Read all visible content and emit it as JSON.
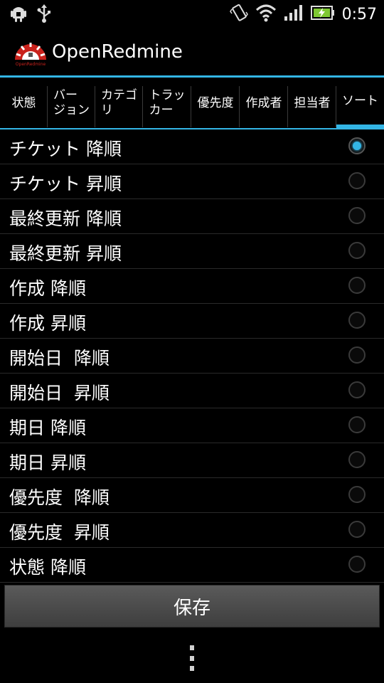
{
  "status_bar": {
    "time": "0:57",
    "icons": [
      "android-debug-icon",
      "usb-icon",
      "vibrate-icon",
      "wifi-icon",
      "signal-icon",
      "battery-charging-icon"
    ]
  },
  "app": {
    "title": "OpenRedmine",
    "logo_text": "OpenRedmine"
  },
  "tabs": [
    {
      "label": "状態"
    },
    {
      "label": "バー\nジョン"
    },
    {
      "label": "カテゴ\nリ"
    },
    {
      "label": "トラッ\nカー"
    },
    {
      "label": "優先度"
    },
    {
      "label": "作成者"
    },
    {
      "label": "担当者"
    },
    {
      "label": "ソート",
      "active": true
    }
  ],
  "sort_options": [
    {
      "label": "チケット 降順",
      "selected": true
    },
    {
      "label": "チケット 昇順",
      "selected": false
    },
    {
      "label": "最終更新 降順",
      "selected": false
    },
    {
      "label": "最終更新 昇順",
      "selected": false
    },
    {
      "label": "作成 降順",
      "selected": false
    },
    {
      "label": "作成 昇順",
      "selected": false
    },
    {
      "label": "開始日  降順",
      "selected": false
    },
    {
      "label": "開始日  昇順",
      "selected": false
    },
    {
      "label": "期日 降順",
      "selected": false
    },
    {
      "label": "期日 昇順",
      "selected": false
    },
    {
      "label": "優先度  降順",
      "selected": false
    },
    {
      "label": "優先度  昇順",
      "selected": false
    },
    {
      "label": "状態 降順",
      "selected": false
    }
  ],
  "save_label": "保存",
  "colors": {
    "accent": "#33b5e5",
    "background": "#000000",
    "button": "#4a4a4a"
  }
}
